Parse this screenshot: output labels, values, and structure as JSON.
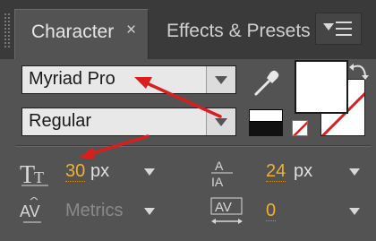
{
  "tabs": [
    {
      "label": "Character",
      "close": "×"
    },
    {
      "label": "Effects & Presets"
    }
  ],
  "font": {
    "family": "Myriad Pro",
    "style": "Regular"
  },
  "size": {
    "value": "30",
    "unit": "px"
  },
  "leading": {
    "value": "24",
    "unit": "px"
  },
  "kerning": {
    "value": "Metrics"
  },
  "tracking": {
    "value": "0"
  },
  "colors": {
    "accent_value": "#f0b030",
    "fill": "#ffffff",
    "annotation_arrow": "#d91e1e"
  },
  "icons": {
    "panel_menu": "panel-menu-icon",
    "eyedropper": "eyedropper-icon",
    "swap": "swap-colors-icon",
    "font_size": "font-size-icon",
    "leading": "leading-icon",
    "kerning": "kerning-icon",
    "tracking": "tracking-icon"
  }
}
